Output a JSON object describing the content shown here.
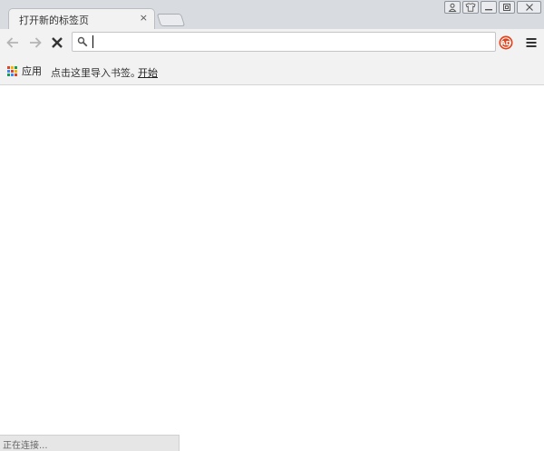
{
  "tab": {
    "title": "打开新的标签页",
    "close_glyph": "×"
  },
  "window_controls": [
    "user-icon",
    "skin-icon",
    "minimize-icon",
    "restore-icon",
    "close-icon"
  ],
  "toolbar": {
    "icons": [
      "back-icon",
      "forward-icon",
      "stop-icon",
      "search-icon",
      "star-icon",
      "adblock-icon",
      "menu-icon"
    ]
  },
  "omnibox": {
    "value": "",
    "placeholder": ""
  },
  "bookmarks": {
    "apps_label": "应用",
    "hint": "点击这里导入书签。",
    "link": "开始"
  },
  "status": {
    "text": "正在连接..."
  },
  "colors": {
    "adblock": "#e0431d",
    "titlebar": "#d8dce1",
    "toolbar": "#f2f2f2"
  }
}
